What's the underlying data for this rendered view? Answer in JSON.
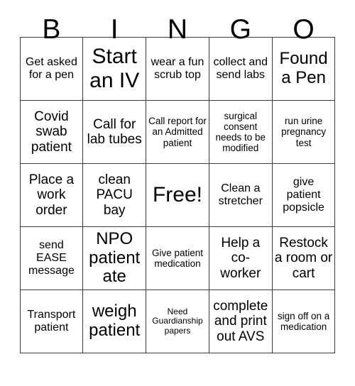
{
  "header": {
    "letters": [
      "B",
      "I",
      "N",
      "G",
      "O"
    ]
  },
  "grid": {
    "rows": [
      [
        {
          "text": "Get asked for a pen",
          "size": "sz-md"
        },
        {
          "text": "Start an IV",
          "size": "sz-xxl"
        },
        {
          "text": "wear a fun scrub top",
          "size": "sz-md"
        },
        {
          "text": "collect and send labs",
          "size": "sz-md"
        },
        {
          "text": "Found a Pen",
          "size": "sz-xl"
        }
      ],
      [
        {
          "text": "Covid swab patient",
          "size": "sz-lg"
        },
        {
          "text": "Call for lab tubes",
          "size": "sz-lg"
        },
        {
          "text": "Call report for an Admitted patient",
          "size": "sz-sm"
        },
        {
          "text": "surgical consent needs to be modified",
          "size": "sz-sm"
        },
        {
          "text": "run urine pregnancy test",
          "size": "sz-sm"
        }
      ],
      [
        {
          "text": "Place a work order",
          "size": "sz-lg"
        },
        {
          "text": "clean PACU bay",
          "size": "sz-lg"
        },
        {
          "text": "Free!",
          "size": "sz-xxl"
        },
        {
          "text": "Clean a stretcher",
          "size": "sz-md"
        },
        {
          "text": "give patient popsicle",
          "size": "sz-md"
        }
      ],
      [
        {
          "text": "send EASE message",
          "size": "sz-md"
        },
        {
          "text": "NPO patient ate",
          "size": "sz-xl"
        },
        {
          "text": "Give patient medication",
          "size": "sz-sm"
        },
        {
          "text": "Help a co-worker",
          "size": "sz-lg"
        },
        {
          "text": "Restock a room or cart",
          "size": "sz-lg"
        }
      ],
      [
        {
          "text": "Transport patient",
          "size": "sz-md"
        },
        {
          "text": "weigh patient",
          "size": "sz-xl"
        },
        {
          "text": "Need Guardianship papers",
          "size": "sz-xs"
        },
        {
          "text": "complete and print out AVS",
          "size": "sz-lg"
        },
        {
          "text": "sign off on a medication",
          "size": "sz-sm"
        }
      ]
    ]
  }
}
